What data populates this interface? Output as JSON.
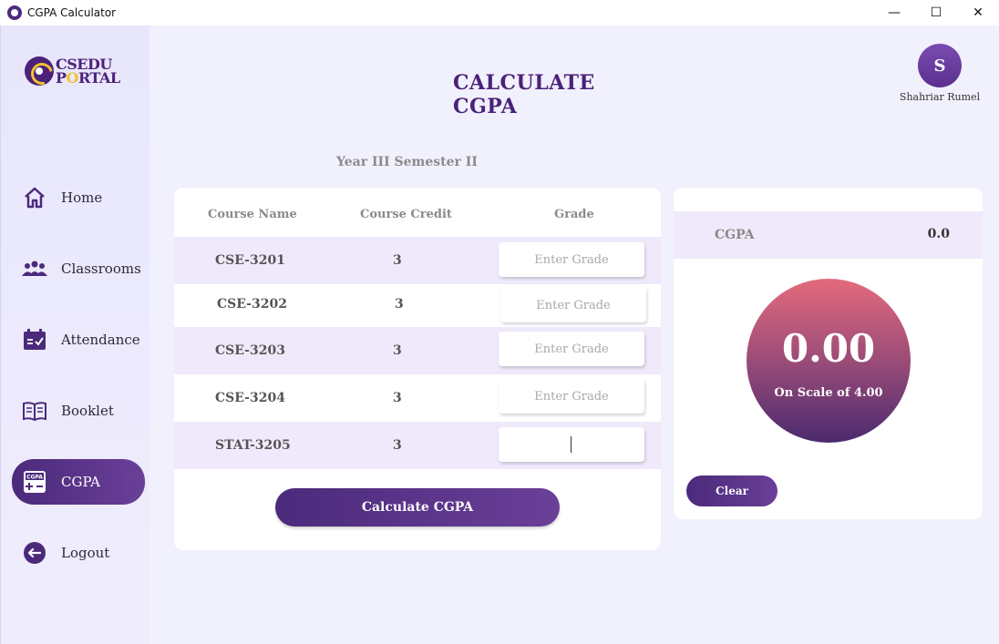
{
  "window": {
    "title": "CGPA Calculator",
    "minimize_icon": "—",
    "maximize_icon": "☐",
    "close_icon": "✕"
  },
  "logo": {
    "line1": "CSEDU",
    "line2_prefix": "P",
    "line2_accent": "O",
    "line2_suffix": "RTAL"
  },
  "sidebar": {
    "items": [
      {
        "label": "Home",
        "icon": "home-icon"
      },
      {
        "label": "Classrooms",
        "icon": "people-icon"
      },
      {
        "label": "Attendance",
        "icon": "calendar-check-icon"
      },
      {
        "label": "Booklet",
        "icon": "book-icon"
      },
      {
        "label": "CGPA",
        "icon": "calculator-icon",
        "active": true,
        "icon_text": "CGPA"
      },
      {
        "label": "Logout",
        "icon": "logout-icon"
      }
    ]
  },
  "header": {
    "title": "CALCULATE CGPA"
  },
  "user": {
    "initial": "S",
    "name": "Shahriar Rumel"
  },
  "semester": "Year III Semester II",
  "table": {
    "headers": [
      "Course Name",
      "Course Credit",
      "Grade"
    ],
    "rows": [
      {
        "course": "CSE-3201",
        "credit": "3",
        "grade": "",
        "placeholder": "Enter Grade"
      },
      {
        "course": "CSE-3202",
        "credit": "3",
        "grade": "",
        "placeholder": "Enter Grade"
      },
      {
        "course": "CSE-3203",
        "credit": "3",
        "grade": "",
        "placeholder": "Enter Grade"
      },
      {
        "course": "CSE-3204",
        "credit": "3",
        "grade": "",
        "placeholder": "Enter Grade"
      },
      {
        "course": "STAT-3205",
        "credit": "3",
        "grade": "",
        "placeholder": ""
      }
    ],
    "calculate_label": "Calculate CGPA"
  },
  "result": {
    "label": "CGPA",
    "value": "0.0",
    "big_value": "0.00",
    "scale": "On Scale of 4.00",
    "clear_label": "Clear"
  },
  "colors": {
    "accent": "#4b2a7b",
    "accent_light": "#6a3f98",
    "row_shade": "#efe9fb",
    "page_bg": "#f1f0fd",
    "logo_yellow": "#f2c230"
  }
}
